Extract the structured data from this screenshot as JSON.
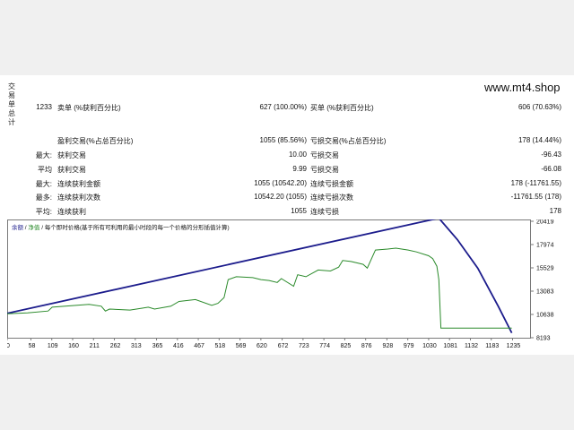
{
  "watermark": "www.mt4.shop",
  "side_label": [
    "交",
    "易",
    "单",
    "总",
    "计"
  ],
  "stats": {
    "row1": {
      "col1_val": "1233",
      "col1_label": "卖单 (%获利百分比)",
      "col2_val": "627 (100.00%)",
      "col2_label": "买单 (%获利百分比)",
      "col3_val": "606 (70.63%)"
    },
    "row2": {
      "col1_label": "盈利交易(%占总百分比)",
      "col2_val": "1055 (85.56%)",
      "col2_label": "亏损交易(%占总百分比)",
      "col3_val": "178 (14.44%)"
    },
    "row3": {
      "col0": "最大:",
      "col1_label": "获利交易",
      "col2_val": "10.00",
      "col2_label": "亏损交易",
      "col3_val": "-96.43"
    },
    "row4": {
      "col0": "平均",
      "col1_label": "获利交易",
      "col2_val": "9.99",
      "col2_label": "亏损交易",
      "col3_val": "-66.08"
    },
    "row5": {
      "col0": "最大:",
      "col1_label": "连续获利金额",
      "col2_val": "1055 (10542.20)",
      "col2_label": "连续亏损金额",
      "col3_val": "178 (-11761.55)"
    },
    "row6": {
      "col0": "最多:",
      "col1_label": "连续获利次数",
      "col2_val": "10542.20 (1055)",
      "col2_label": "连续亏损次数",
      "col3_val": "-11761.55 (178)"
    },
    "row7": {
      "col0": "平均:",
      "col1_label": "连续获利",
      "col2_val": "1055",
      "col2_label": "连续亏损",
      "col3_val": "178"
    }
  },
  "legend": {
    "balance": "余额",
    "sep": " / ",
    "equity": "净值",
    "note": " / 每个即时价格(基于所有可利用的最小时段的每一个价格的分形插值计算)"
  },
  "chart_data": {
    "type": "line",
    "x_ticks": [
      "0",
      "58",
      "109",
      "160",
      "211",
      "262",
      "313",
      "365",
      "416",
      "467",
      "518",
      "569",
      "620",
      "672",
      "723",
      "774",
      "825",
      "876",
      "928",
      "979",
      "1030",
      "1081",
      "1132",
      "1183",
      "1235"
    ],
    "y_ticks": [
      "20419",
      "17974",
      "15529",
      "13083",
      "10638",
      "8193"
    ],
    "xlim": [
      0,
      1280
    ],
    "ylim": [
      8193,
      20419
    ],
    "series": [
      {
        "key": "balance",
        "color": "#1c1c8c",
        "x": [
          0,
          1055,
          1100,
          1150,
          1200,
          1233
        ],
        "y": [
          10750,
          20750,
          18500,
          15500,
          11500,
          8700
        ]
      },
      {
        "key": "equity",
        "color": "#2a8a2a",
        "x": [
          0,
          50,
          100,
          110,
          200,
          230,
          240,
          250,
          300,
          330,
          345,
          360,
          400,
          420,
          460,
          500,
          515,
          530,
          540,
          560,
          600,
          620,
          640,
          660,
          670,
          700,
          710,
          730,
          760,
          790,
          810,
          820,
          840,
          860,
          870,
          880,
          900,
          930,
          950,
          980,
          1000,
          1030,
          1040,
          1050,
          1055,
          1060,
          1233
        ],
        "y": [
          10700,
          10800,
          11000,
          11400,
          11700,
          11500,
          11000,
          11200,
          11100,
          11300,
          11400,
          11200,
          11500,
          12000,
          12200,
          11600,
          11800,
          12400,
          14300,
          14600,
          14500,
          14300,
          14200,
          14000,
          14400,
          13600,
          14800,
          14600,
          15300,
          15200,
          15600,
          16300,
          16200,
          16000,
          15900,
          15500,
          17400,
          17500,
          17600,
          17400,
          17200,
          16800,
          16500,
          15700,
          14300,
          9200,
          9200
        ]
      }
    ]
  }
}
